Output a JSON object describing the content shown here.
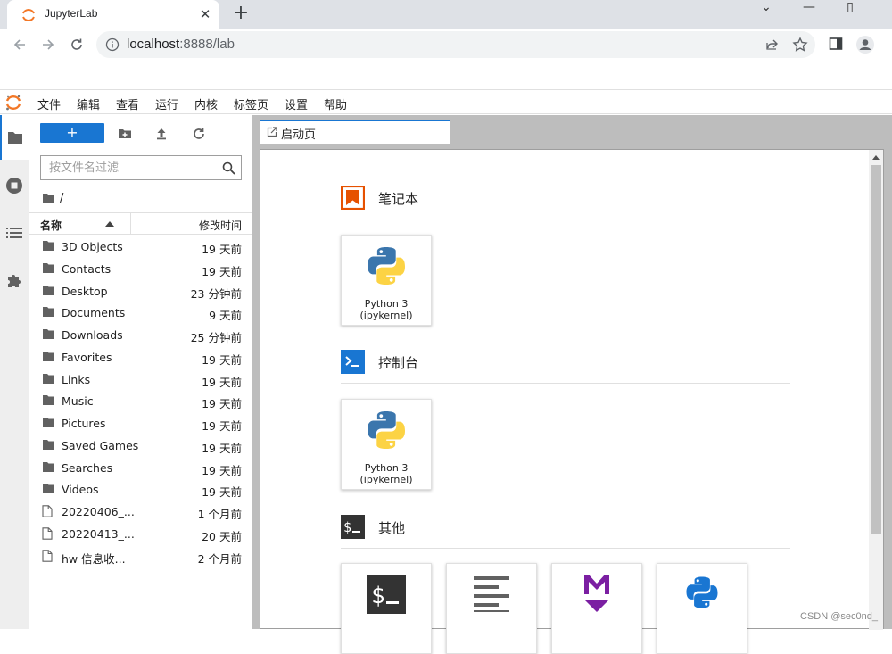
{
  "browser": {
    "tab_title": "JupyterLab",
    "url_host": "localhost",
    "url_path": ":8888/lab"
  },
  "menubar": {
    "items": [
      "文件",
      "编辑",
      "查看",
      "运行",
      "内核",
      "标签页",
      "设置",
      "帮助"
    ]
  },
  "filebrowser": {
    "new_label": "+",
    "filter_placeholder": "按文件名过滤",
    "breadcrumb": "/",
    "col_name": "名称",
    "col_modified": "修改时间",
    "files": [
      {
        "name": "3D Objects",
        "modified": "19 天前",
        "type": "folder"
      },
      {
        "name": "Contacts",
        "modified": "19 天前",
        "type": "folder"
      },
      {
        "name": "Desktop",
        "modified": "23 分钟前",
        "type": "folder"
      },
      {
        "name": "Documents",
        "modified": "9 天前",
        "type": "folder"
      },
      {
        "name": "Downloads",
        "modified": "25 分钟前",
        "type": "folder"
      },
      {
        "name": "Favorites",
        "modified": "19 天前",
        "type": "folder"
      },
      {
        "name": "Links",
        "modified": "19 天前",
        "type": "folder"
      },
      {
        "name": "Music",
        "modified": "19 天前",
        "type": "folder"
      },
      {
        "name": "Pictures",
        "modified": "19 天前",
        "type": "folder"
      },
      {
        "name": "Saved Games",
        "modified": "19 天前",
        "type": "folder"
      },
      {
        "name": "Searches",
        "modified": "19 天前",
        "type": "folder"
      },
      {
        "name": "Videos",
        "modified": "19 天前",
        "type": "folder"
      },
      {
        "name": "20220406_...",
        "modified": "1 个月前",
        "type": "file"
      },
      {
        "name": "20220413_...",
        "modified": "20 天前",
        "type": "file"
      },
      {
        "name": "hw 信息收...",
        "modified": "2 个月前",
        "type": "file"
      }
    ]
  },
  "launcher": {
    "tab_label": "启动页",
    "sections": {
      "notebook": "笔记本",
      "console": "控制台",
      "other": "其他"
    },
    "kernel_line1": "Python 3",
    "kernel_line2": "(ipykernel)"
  },
  "colors": {
    "accent": "#1976d2",
    "notebook_icon": "#e65100",
    "console_icon": "#1976d2",
    "other_icon": "#333333",
    "markdown": "#7b1fa2"
  },
  "watermark": "CSDN @sec0nd_"
}
